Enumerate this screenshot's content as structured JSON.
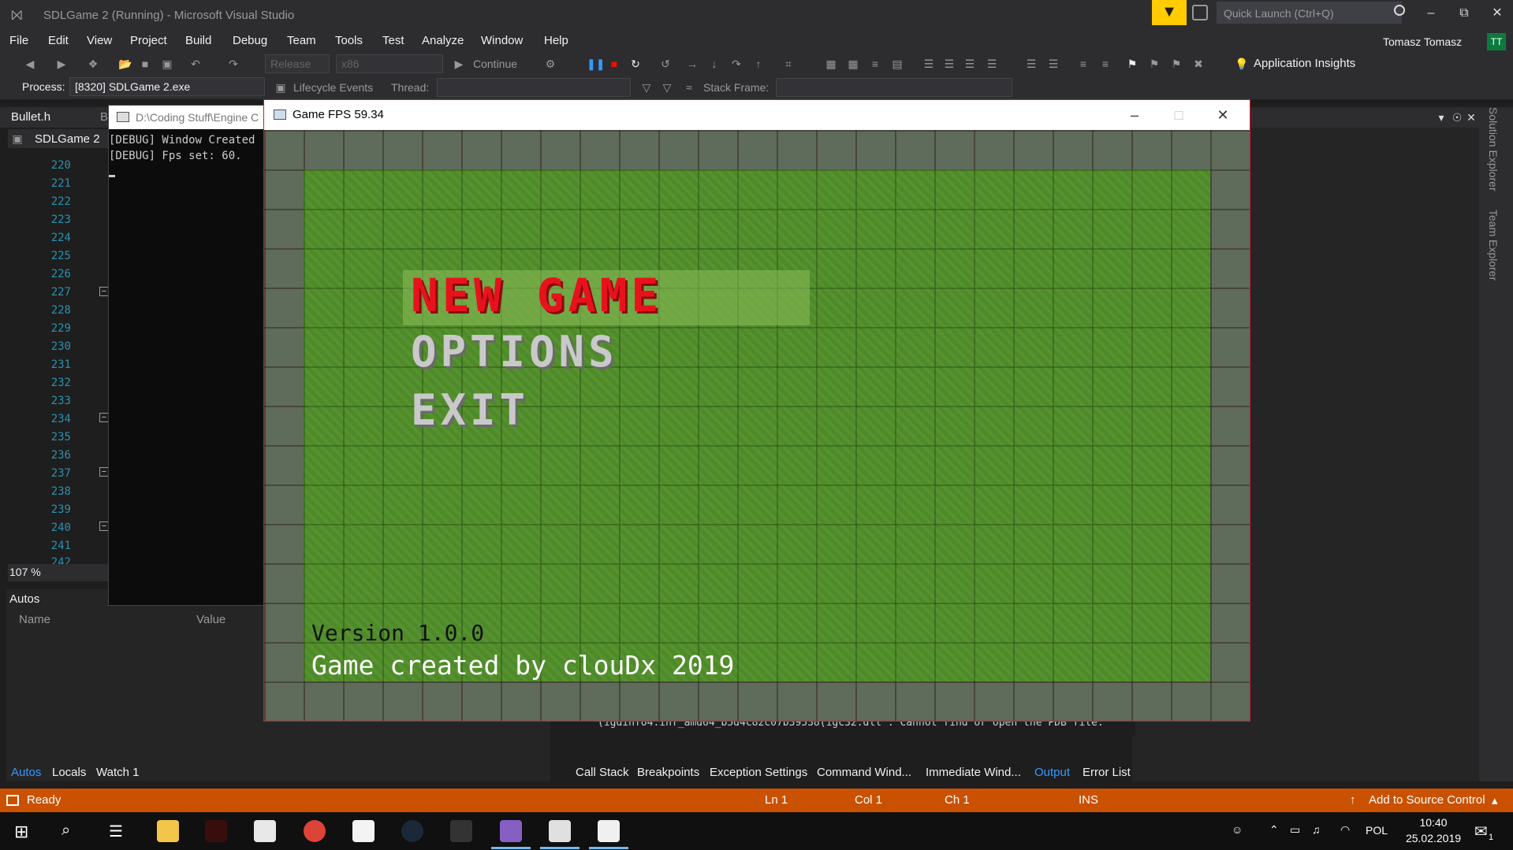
{
  "window": {
    "title": "SDLGame 2 (Running) - Microsoft Visual Studio",
    "quick_launch_placeholder": "Quick Launch (Ctrl+Q)",
    "user_name": "Tomasz Tomasz",
    "user_initials": "TT"
  },
  "menu": [
    "File",
    "Edit",
    "View",
    "Project",
    "Build",
    "Debug",
    "Team",
    "Tools",
    "Test",
    "Analyze",
    "Window",
    "Help"
  ],
  "toolbar": {
    "config": "Release",
    "platform": "x86",
    "continue_label": "Continue",
    "app_insights": "Application Insights"
  },
  "debug_location": {
    "process_label": "Process:",
    "process_value": "[8320] SDLGame 2.exe",
    "lifecycle_label": "Lifecycle Events",
    "thread_label": "Thread:",
    "stack_frame_label": "Stack Frame:"
  },
  "editor": {
    "tab_label": "Bullet.h",
    "tab_label_2": "B",
    "project_name": "SDLGame 2",
    "line_numbers": [
      "220",
      "221",
      "222",
      "223",
      "224",
      "225",
      "226",
      "227",
      "228",
      "229",
      "230",
      "231",
      "232",
      "233",
      "234",
      "235",
      "236",
      "237",
      "238",
      "239",
      "240",
      "241",
      "242"
    ],
    "zoom": "107 %"
  },
  "console": {
    "title": "D:\\Coding Stuff\\Engine C",
    "lines": [
      "[DEBUG] Window Created",
      "[DEBUG] Fps set: 60."
    ]
  },
  "autos": {
    "title": "Autos",
    "col_name": "Name",
    "col_value": "Value",
    "tabs": [
      "Autos",
      "Locals",
      "Watch 1"
    ]
  },
  "output": {
    "truncated_line": "(igdinfo4.inf_amd64_b5d4c82c07b39538(igc32.dll . Cannot find or open the PDB file."
  },
  "bottom_tabs": [
    "Call Stack",
    "Breakpoints",
    "Exception Settings",
    "Command Wind...",
    "Immediate Wind...",
    "Output",
    "Error List"
  ],
  "side_tabs": [
    "Solution Explorer",
    "Team Explorer"
  ],
  "game": {
    "title": "Game FPS 59.34",
    "menu_new": "NEW GAME",
    "menu_options": "OPTIONS",
    "menu_exit": "EXIT",
    "version": "Version 1.0.0",
    "credit": "Game created by clouDx 2019"
  },
  "status": {
    "state": "Ready",
    "ln": "Ln 1",
    "col": "Col 1",
    "ch": "Ch 1",
    "mode": "INS",
    "source_control": "Add to Source Control"
  },
  "taskbar": {
    "language": "POL",
    "time": "10:40",
    "date": "25.02.2019",
    "notification_count": "1"
  },
  "colors": {
    "status_bar": "#ca5100",
    "accent_yellow": "#ffcc00",
    "menu_selected": "#e8121c",
    "grass": "#4e8a2a"
  }
}
